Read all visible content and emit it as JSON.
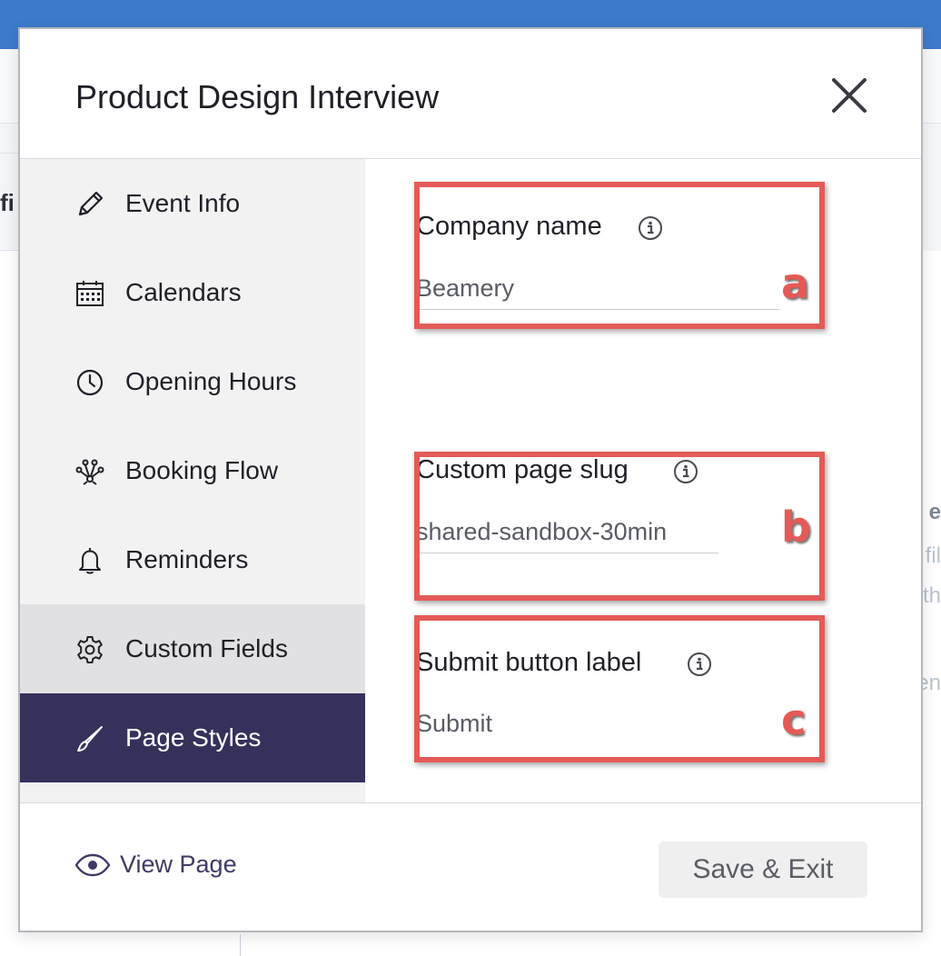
{
  "background": {
    "left_fragment": "fi",
    "right_fragments": [
      "e",
      "fil",
      "th",
      "en"
    ]
  },
  "modal": {
    "title": "Product Design Interview",
    "close_icon": "close-icon"
  },
  "sidebar": {
    "items": [
      {
        "label": "Event Info",
        "icon": "pencil-icon",
        "state": "default"
      },
      {
        "label": "Calendars",
        "icon": "calendar-icon",
        "state": "default"
      },
      {
        "label": "Opening Hours",
        "icon": "clock-icon",
        "state": "default"
      },
      {
        "label": "Booking Flow",
        "icon": "flow-icon",
        "state": "default"
      },
      {
        "label": "Reminders",
        "icon": "bell-icon",
        "state": "default"
      },
      {
        "label": "Custom Fields",
        "icon": "gear-icon",
        "state": "hover"
      },
      {
        "label": "Page Styles",
        "icon": "brush-icon",
        "state": "active"
      }
    ]
  },
  "fields": [
    {
      "label": "Company name",
      "value": "Beamery",
      "annotation": "a"
    },
    {
      "label": "Custom page slug",
      "value": "shared-sandbox-30min",
      "annotation": "b"
    },
    {
      "label": "Submit button label",
      "value": "Submit",
      "annotation": "c"
    }
  ],
  "footer": {
    "view_page_label": "View Page",
    "save_label": "Save & Exit"
  },
  "colors": {
    "topbar": "#3d7acb",
    "active_nav": "#34315b",
    "annotation": "#e45a56"
  }
}
